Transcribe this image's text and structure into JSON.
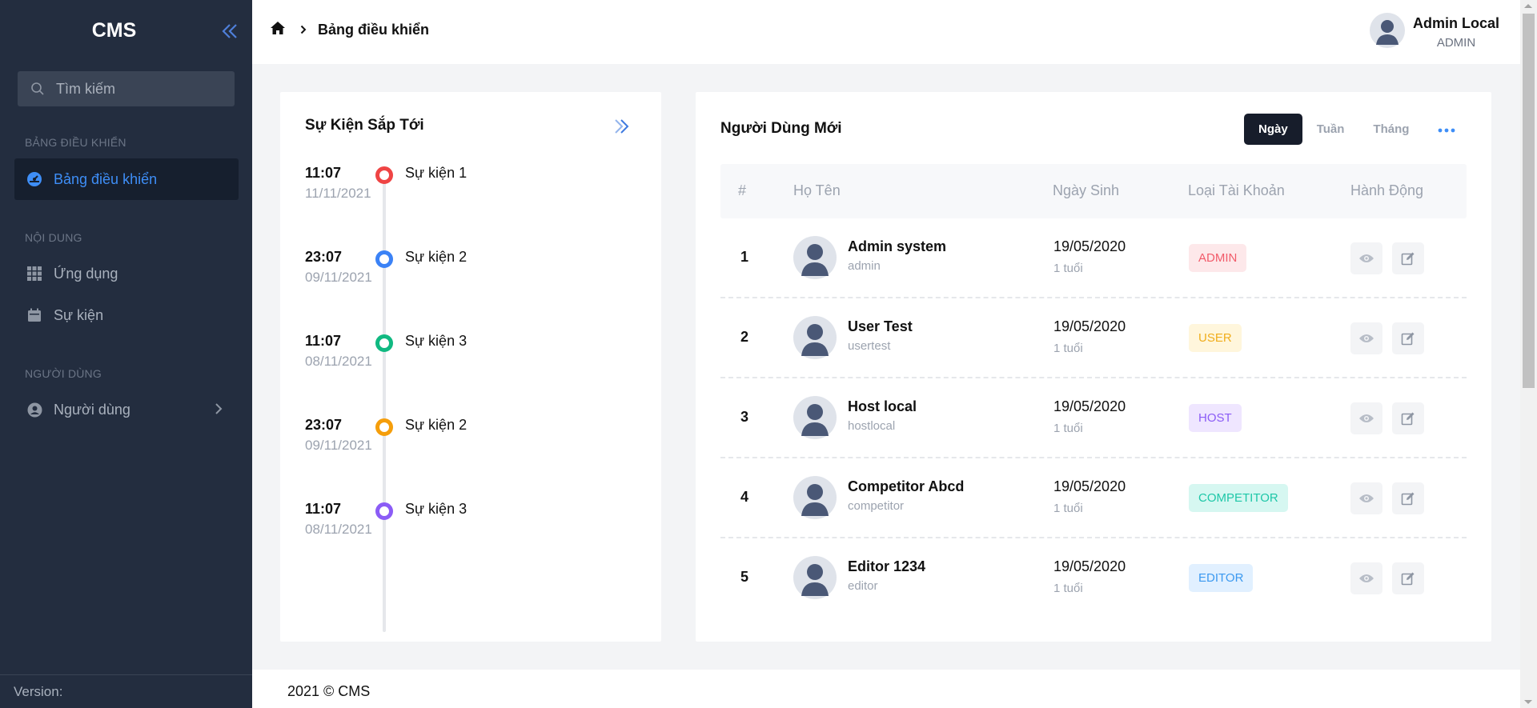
{
  "sidebar": {
    "brand": "CMS",
    "search_placeholder": "Tìm kiếm",
    "sections": {
      "dashboard": "BẢNG ĐIỀU KHIỂN",
      "content": "NỘI DUNG",
      "users": "NGƯỜI DÙNG"
    },
    "items": {
      "dashboard": "Bảng điều khiển",
      "apps": "Ứng dụng",
      "events": "Sự kiện",
      "users": "Người dùng"
    },
    "version": "Version:"
  },
  "header": {
    "breadcrumb_current": "Bảng điều khiển",
    "user_name": "Admin Local",
    "user_role": "ADMIN"
  },
  "events_card": {
    "title": "Sự Kiện Sắp Tới",
    "events": [
      {
        "time": "11:07",
        "date": "11/11/2021",
        "title": "Sự kiện 1",
        "color": "#ef4444"
      },
      {
        "time": "23:07",
        "date": "09/11/2021",
        "title": "Sự kiện 2",
        "color": "#3b82f6"
      },
      {
        "time": "11:07",
        "date": "08/11/2021",
        "title": "Sự kiện 3",
        "color": "#10b981"
      },
      {
        "time": "23:07",
        "date": "09/11/2021",
        "title": "Sự kiện 2",
        "color": "#f59e0b"
      },
      {
        "time": "11:07",
        "date": "08/11/2021",
        "title": "Sự kiện 3",
        "color": "#8b5cf6"
      }
    ]
  },
  "users_card": {
    "title": "Người Dùng Mới",
    "tabs": [
      "Ngày",
      "Tuần",
      "Tháng"
    ],
    "active_tab": "Ngày",
    "columns": [
      "#",
      "Họ Tên",
      "Ngày Sinh",
      "Loại Tài Khoản",
      "Hành Động"
    ],
    "rows": [
      {
        "idx": "1",
        "name": "Admin system",
        "username": "admin",
        "dob": "19/05/2020",
        "age": "1 tuổi",
        "role": "ADMIN",
        "role_bg": "#fde8ea",
        "role_fg": "#f25b6a"
      },
      {
        "idx": "2",
        "name": "User Test",
        "username": "usertest",
        "dob": "19/05/2020",
        "age": "1 tuổi",
        "role": "USER",
        "role_bg": "#fff6dc",
        "role_fg": "#f0ad1c"
      },
      {
        "idx": "3",
        "name": "Host local",
        "username": "hostlocal",
        "dob": "19/05/2020",
        "age": "1 tuổi",
        "role": "HOST",
        "role_bg": "#efe6ff",
        "role_fg": "#8b5cf6"
      },
      {
        "idx": "4",
        "name": "Competitor Abcd",
        "username": "competitor",
        "dob": "19/05/2020",
        "age": "1 tuổi",
        "role": "COMPETITOR",
        "role_bg": "#d6f7f1",
        "role_fg": "#1ec7a8"
      },
      {
        "idx": "5",
        "name": "Editor 1234",
        "username": "editor",
        "dob": "19/05/2020",
        "age": "1 tuổi",
        "role": "EDITOR",
        "role_bg": "#e1f0ff",
        "role_fg": "#3b99f0"
      }
    ]
  },
  "footer": {
    "text": "2021 © CMS"
  },
  "colors": {
    "accent": "#3e8ef7",
    "sidebar_bg": "#232d3f"
  }
}
